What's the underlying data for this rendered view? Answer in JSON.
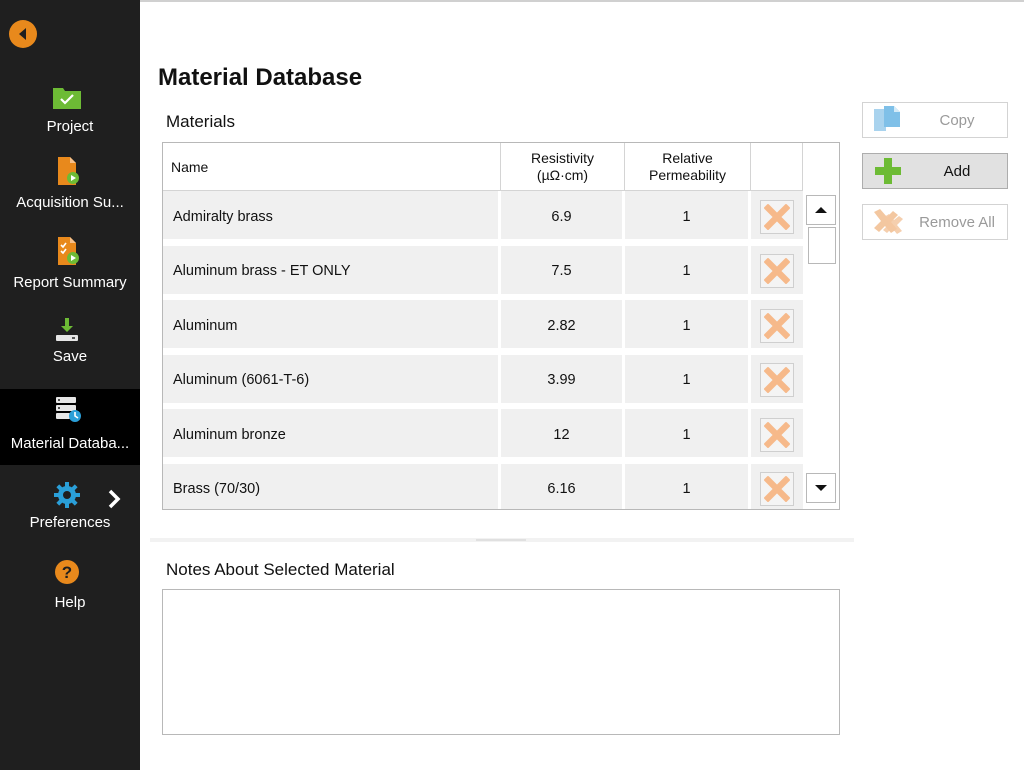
{
  "sidebar": {
    "items": [
      {
        "label": "Project",
        "icon": "folder-check-icon"
      },
      {
        "label": "Acquisition Su...",
        "icon": "acquisition-document-icon"
      },
      {
        "label": "Report Summary",
        "icon": "report-document-icon"
      },
      {
        "label": "Save",
        "icon": "download-save-icon"
      },
      {
        "label": "Material Databa...",
        "icon": "database-icon",
        "active": true
      },
      {
        "label": "Preferences",
        "icon": "gear-icon"
      },
      {
        "label": "Help",
        "icon": "help-icon"
      }
    ],
    "accent": "#e8891c"
  },
  "page": {
    "title": "Material Database",
    "materials_label": "Materials",
    "notes_label": "Notes About Selected Material",
    "notes_text": ""
  },
  "table": {
    "headers": {
      "name": "Name",
      "resistivity_line1": "Resistivity",
      "resistivity_line2": "(µΩ·cm)",
      "permeability_line1": "Relative",
      "permeability_line2": "Permeability"
    },
    "rows": [
      {
        "name": "Admiralty brass",
        "resistivity": "6.9",
        "permeability": "1"
      },
      {
        "name": "Aluminum brass - ET ONLY",
        "resistivity": "7.5",
        "permeability": "1"
      },
      {
        "name": "Aluminum",
        "resistivity": "2.82",
        "permeability": "1"
      },
      {
        "name": "Aluminum (6061-T-6)",
        "resistivity": "3.99",
        "permeability": "1"
      },
      {
        "name": "Aluminum bronze",
        "resistivity": "12",
        "permeability": "1"
      },
      {
        "name": "Brass (70/30)",
        "resistivity": "6.16",
        "permeability": "1"
      }
    ]
  },
  "actions": {
    "copy_label": "Copy",
    "add_label": "Add",
    "remove_all_label": "Remove All"
  }
}
